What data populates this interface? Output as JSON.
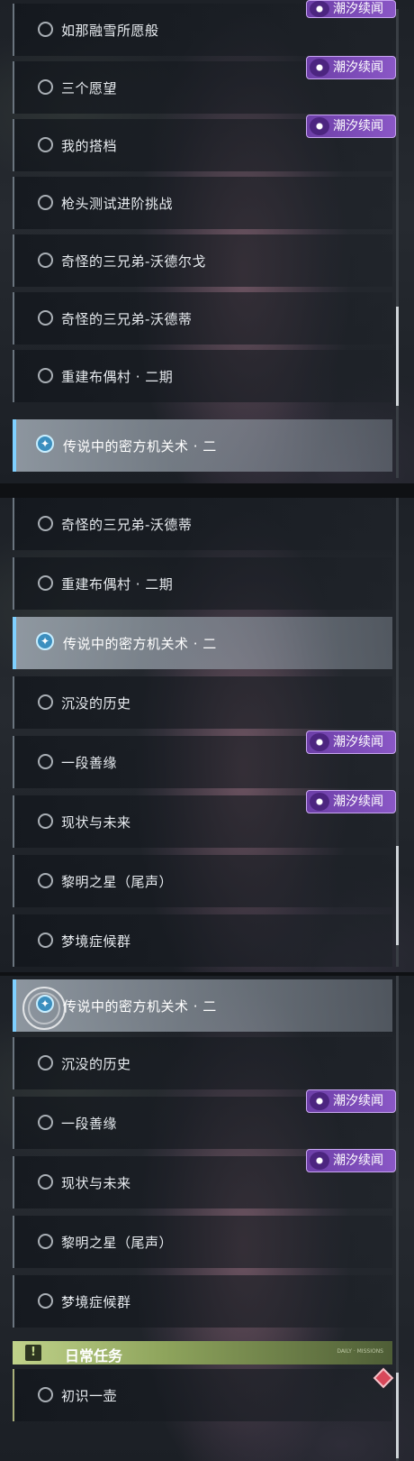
{
  "badge": {
    "text": "潮汐续闻",
    "icon": "tide-story-icon"
  },
  "panel1": {
    "items": [
      {
        "label": "如那融雪所愿般",
        "active": false
      },
      {
        "label": "三个愿望",
        "active": false
      },
      {
        "label": "我的搭档",
        "active": false
      },
      {
        "label": "枪头测试进阶挑战",
        "active": false
      },
      {
        "label": "奇怪的三兄弟-沃德尔戈",
        "active": false
      },
      {
        "label": "奇怪的三兄弟-沃德蒂",
        "active": false
      },
      {
        "label": "重建布偶村 · 二期",
        "active": false
      },
      {
        "label": "传说中的密方机关术 · 二",
        "active": true
      }
    ]
  },
  "panel2": {
    "items": [
      {
        "label": "奇怪的三兄弟-沃德蒂",
        "active": false
      },
      {
        "label": "重建布偶村 · 二期",
        "active": false
      },
      {
        "label": "传说中的密方机关术 · 二",
        "active": true
      },
      {
        "label": "沉没的历史",
        "active": false
      },
      {
        "label": "一段善缘",
        "active": false
      },
      {
        "label": "现状与未来",
        "active": false
      },
      {
        "label": "黎明之星（尾声）",
        "active": false
      },
      {
        "label": "梦境症候群",
        "active": false
      }
    ]
  },
  "panel3": {
    "items": [
      {
        "label": "传说中的密方机关术 · 二",
        "active": true
      },
      {
        "label": "沉没的历史",
        "active": false
      },
      {
        "label": "一段善缘",
        "active": false
      },
      {
        "label": "现状与未来",
        "active": false
      },
      {
        "label": "黎明之星（尾声）",
        "active": false
      },
      {
        "label": "梦境症候群",
        "active": false
      }
    ],
    "section_header": {
      "label": "日常任务",
      "icon_text": "!",
      "small_text": "DAILY · MISSIONS"
    },
    "daily_items": [
      {
        "label": "初识一壶",
        "active": false
      }
    ]
  },
  "colors": {
    "badge": "#7a4bb8",
    "active_border": "#7fd0ff",
    "daily_header": "#b6c97e",
    "tracked_marker": "#d8485a"
  }
}
